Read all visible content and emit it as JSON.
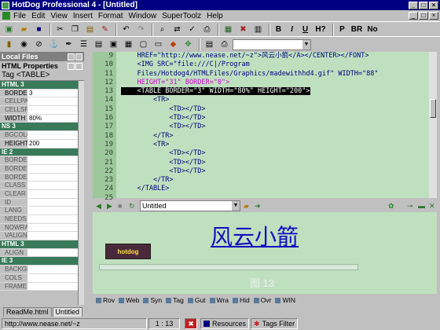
{
  "window": {
    "title": "HotDog Professional 4 - [Untitled]"
  },
  "menu": [
    "File",
    "Edit",
    "View",
    "Insert",
    "Format",
    "Window",
    "SuperToolz",
    "Help"
  ],
  "toolbar_format": {
    "bold": "B",
    "italic": "I",
    "underline": "U",
    "heading": "H?",
    "paragraph": "P",
    "linebreak": "BR",
    "nobreak": "No"
  },
  "left_panel": {
    "local_files_title": "Local Files",
    "html_properties_title": "HTML Properties",
    "tag_line": "Tag <TABLE>",
    "rows": [
      {
        "name": "HTML 3",
        "value": "",
        "kind": "group"
      },
      {
        "name": "BORDER",
        "value": "3",
        "kind": "active"
      },
      {
        "name": "CELLPA",
        "value": "",
        "kind": "prop"
      },
      {
        "name": "CELLSP",
        "value": "",
        "kind": "prop"
      },
      {
        "name": "WIDTH",
        "value": "80%",
        "kind": "active"
      },
      {
        "name": "NS 3",
        "value": "",
        "kind": "group"
      },
      {
        "name": "BGCOLO",
        "value": "",
        "kind": "prop"
      },
      {
        "name": "HEIGHT",
        "value": "200",
        "kind": "active"
      },
      {
        "name": "IE 2",
        "value": "",
        "kind": "group"
      },
      {
        "name": "BORDER",
        "value": "",
        "kind": "prop"
      },
      {
        "name": "BORDER",
        "value": "",
        "kind": "prop"
      },
      {
        "name": "BORDER",
        "value": "",
        "kind": "prop"
      },
      {
        "name": "CLASS",
        "value": "",
        "kind": "prop"
      },
      {
        "name": "CLEAR",
        "value": "",
        "kind": "prop"
      },
      {
        "name": "ID",
        "value": "",
        "kind": "prop"
      },
      {
        "name": "LANG",
        "value": "",
        "kind": "prop"
      },
      {
        "name": "NEEDS",
        "value": "",
        "kind": "prop"
      },
      {
        "name": "NOWRA",
        "value": "",
        "kind": "prop"
      },
      {
        "name": "VALIGN",
        "value": "",
        "kind": "prop"
      },
      {
        "name": "HTML 3",
        "value": "",
        "kind": "group"
      },
      {
        "name": "ALIGN",
        "value": "",
        "kind": "prop"
      },
      {
        "name": "IE 3",
        "value": "",
        "kind": "group"
      },
      {
        "name": "BACKGR",
        "value": "",
        "kind": "prop"
      },
      {
        "name": "COLS",
        "value": "",
        "kind": "prop"
      },
      {
        "name": "FRAME",
        "value": "",
        "kind": "prop"
      }
    ]
  },
  "editor": {
    "line_numbers": [
      "9",
      "10",
      "11",
      "12",
      "13",
      "14",
      "15",
      "16",
      "17",
      "18",
      "19",
      "20",
      "21",
      "22",
      "23",
      "24",
      "25"
    ],
    "lines": [
      "    HREF=\"http://www.nease.net/~z\">风云小箭</A></CENTER></FONT>",
      "    <IMG SRC=\"file:///C|/Program",
      "    Files/Hotdog4/HTMLFiles/Graphics/madewithhd4.gif\" WIDTH=\"88\"",
      "    HEIGHT=\"31\" BORDER=\"0\">",
      "    <TABLE BORDER=\"3\" WIDTH=\"80%\" HEIGHT=\"200\">",
      "        <TR>",
      "            <TD></TD>",
      "            <TD></TD>",
      "            <TD></TD>",
      "        </TR>",
      "        <TR>",
      "            <TD></TD>",
      "            <TD></TD>",
      "            <TD></TD>",
      "        </TR>",
      "    </TABLE>",
      ""
    ]
  },
  "preview_bar": {
    "url": "Untitled"
  },
  "preview": {
    "title": "风云小箭",
    "logo_text": "hotdog",
    "figure": "图 13"
  },
  "bottom_toolbar": [
    "Rov",
    "Web",
    "Syn",
    "Tag",
    "Gut",
    "Wra",
    "Hid",
    "Ovr",
    "WIN"
  ],
  "tabs": [
    "ReadMe.html",
    "Untitled"
  ],
  "status": {
    "url": "http://www.nease.net/~z",
    "position": "1 : 13",
    "resources": "Resources",
    "tags_filter": "Tags Filter"
  }
}
